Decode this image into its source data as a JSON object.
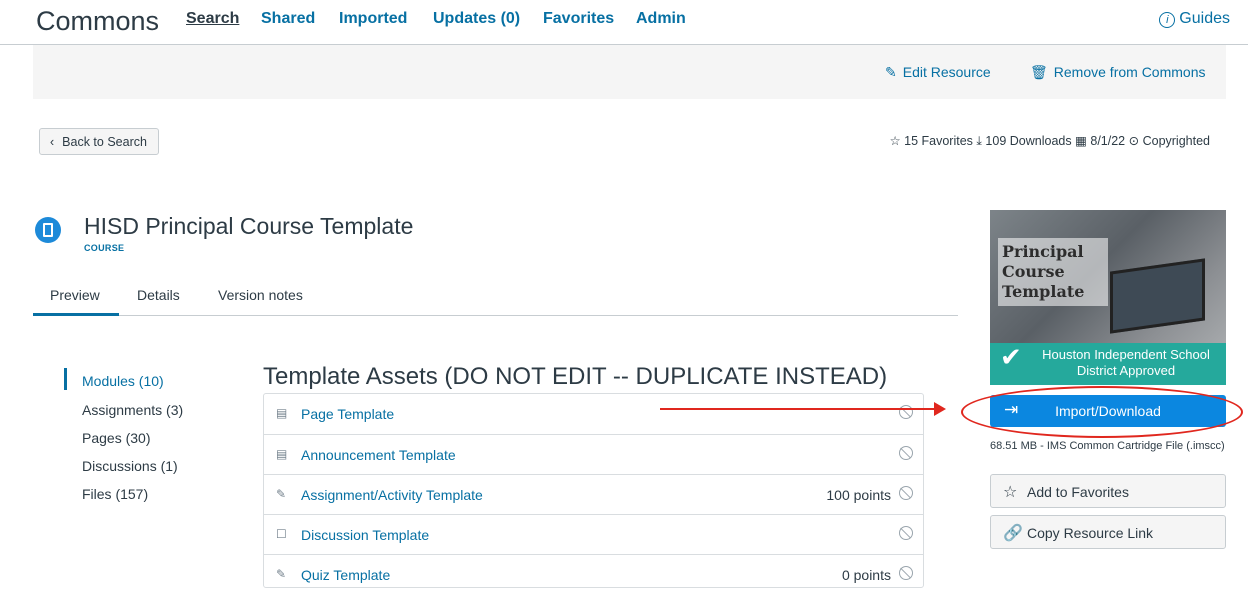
{
  "nav": {
    "brand": "Commons",
    "links": [
      "Search",
      "Shared",
      "Imported",
      "Updates (0)",
      "Favorites",
      "Admin"
    ],
    "guides": "Guides"
  },
  "actions": {
    "edit": "Edit Resource",
    "remove": "Remove from Commons"
  },
  "back_label": "Back to Search",
  "meta": {
    "favorites": "15 Favorites",
    "downloads": "109 Downloads",
    "date": "8/1/22",
    "license": "Copyrighted"
  },
  "resource": {
    "title": "HISD Principal Course Template",
    "type": "COURSE"
  },
  "tabs": [
    "Preview",
    "Details",
    "Version notes"
  ],
  "sidebar": [
    "Modules (10)",
    "Assignments (3)",
    "Pages (30)",
    "Discussions (1)",
    "Files (157)"
  ],
  "module": {
    "title": "Template Assets (DO NOT EDIT -- DUPLICATE INSTEAD)",
    "items": [
      {
        "label": "Page Template",
        "points": "",
        "icon": "page-icon"
      },
      {
        "label": "Announcement Template",
        "points": "",
        "icon": "page-icon"
      },
      {
        "label": "Assignment/Activity Template",
        "points": "100 points",
        "icon": "assignment-icon"
      },
      {
        "label": "Discussion Template",
        "points": "",
        "icon": "discussion-icon"
      },
      {
        "label": "Quiz Template",
        "points": "0 points",
        "icon": "quiz-icon"
      }
    ]
  },
  "thumbnail": {
    "text": "Principal Course Template",
    "approved": "Houston Independent School District Approved"
  },
  "import_label": "Import/Download",
  "file_meta": "68.51 MB - IMS Common Cartridge File (.imscc)",
  "favorite_label": "Add to Favorites",
  "copy_label": "Copy Resource Link",
  "colors": {
    "link": "#0770a3",
    "primary_button": "#0b87e0",
    "approved_banner": "#25a99c",
    "annotation": "#e0271e"
  }
}
